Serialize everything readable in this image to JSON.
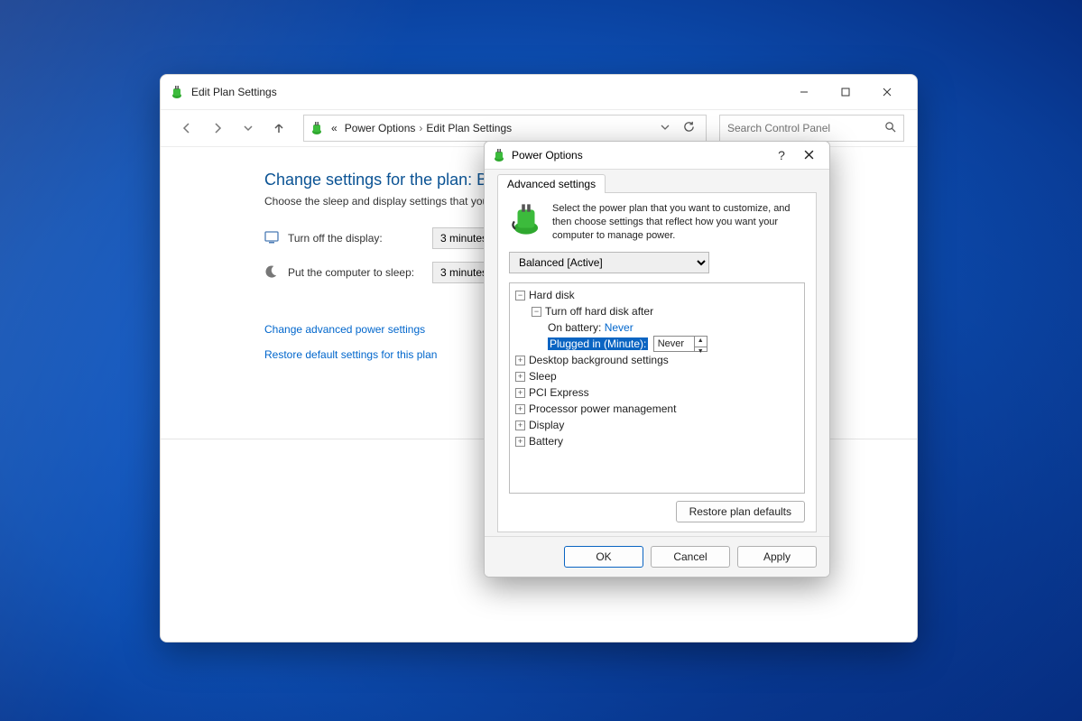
{
  "window": {
    "title": "Edit Plan Settings",
    "breadcrumb_root": "«",
    "breadcrumb1": "Power Options",
    "breadcrumb2": "Edit Plan Settings",
    "search_placeholder": "Search Control Panel"
  },
  "page": {
    "heading": "Change settings for the plan: Balanced",
    "subtext": "Choose the sleep and display settings that you want your computer to use.",
    "row1_label": "Turn off the display:",
    "row1_value": "3 minutes",
    "row2_label": "Put the computer to sleep:",
    "row2_value": "3 minutes",
    "link1": "Change advanced power settings",
    "link2": "Restore default settings for this plan"
  },
  "dialog": {
    "title": "Power Options",
    "tab": "Advanced settings",
    "intro": "Select the power plan that you want to customize, and then choose settings that reflect how you want your computer to manage power.",
    "plan_selected": "Balanced [Active]",
    "tree": {
      "hard_disk": "Hard disk",
      "turn_off_after": "Turn off hard disk after",
      "on_battery_label": "On battery:",
      "on_battery_value": "Never",
      "plugged_in_label": "Plugged in (Minute):",
      "plugged_in_value": "Never",
      "desktop_bg": "Desktop background settings",
      "sleep": "Sleep",
      "pci": "PCI Express",
      "processor": "Processor power management",
      "display": "Display",
      "battery": "Battery"
    },
    "restore_defaults": "Restore plan defaults",
    "ok": "OK",
    "cancel": "Cancel",
    "apply": "Apply"
  }
}
